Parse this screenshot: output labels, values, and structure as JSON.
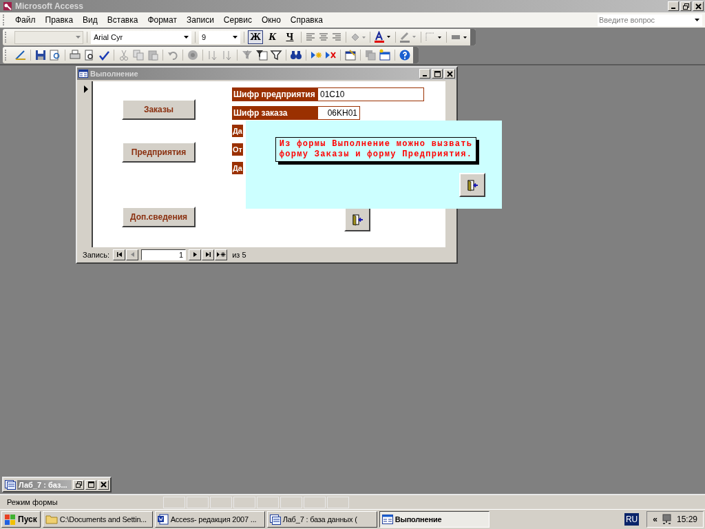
{
  "window": {
    "title": "Microsoft Access"
  },
  "menu": [
    "Файл",
    "Правка",
    "Вид",
    "Вставка",
    "Формат",
    "Записи",
    "Сервис",
    "Окно",
    "Справка"
  ],
  "help_box": {
    "placeholder": "Введите вопрос"
  },
  "format_toolbar": {
    "font": "Arial Cyr",
    "size": "9",
    "styles": [
      {
        "label": "Ж",
        "selected": true
      },
      {
        "label": "К",
        "selected": false
      },
      {
        "label": "Ч",
        "selected": false
      }
    ]
  },
  "form_window": {
    "title": "Выполнение",
    "buttons": [
      "Заказы",
      "Предприятия",
      "Доп.сведения"
    ],
    "fields": [
      {
        "label": "Шифр предприятия",
        "value": "01C10"
      },
      {
        "label": "Шифр заказа",
        "value": "06KH01"
      },
      {
        "label": "Да"
      },
      {
        "label": "От"
      },
      {
        "label": "Да"
      }
    ],
    "navigation": {
      "label": "Запись:",
      "record": "1",
      "total": "из 5"
    }
  },
  "popup": {
    "lines": [
      "Из формы Выполнение можно вызвать",
      "форму Заказы и форму Предприятия."
    ]
  },
  "minimized_window": {
    "title": "Лаб_7 : баз..."
  },
  "status_bar": {
    "text": "Режим формы"
  },
  "taskbar": {
    "start": "Пуск",
    "tasks": [
      {
        "label": "C:\\Documents and Settin...",
        "kind": "folder",
        "selected": false
      },
      {
        "label": "Access- редакция 2007 ...",
        "kind": "word",
        "selected": false
      },
      {
        "label": "Лаб_7 : база данных (",
        "kind": "db",
        "selected": false
      },
      {
        "label": "Выполнение",
        "kind": "form",
        "selected": true
      }
    ],
    "language": "RU",
    "tray_toggle": "«",
    "clock": "15:29"
  }
}
